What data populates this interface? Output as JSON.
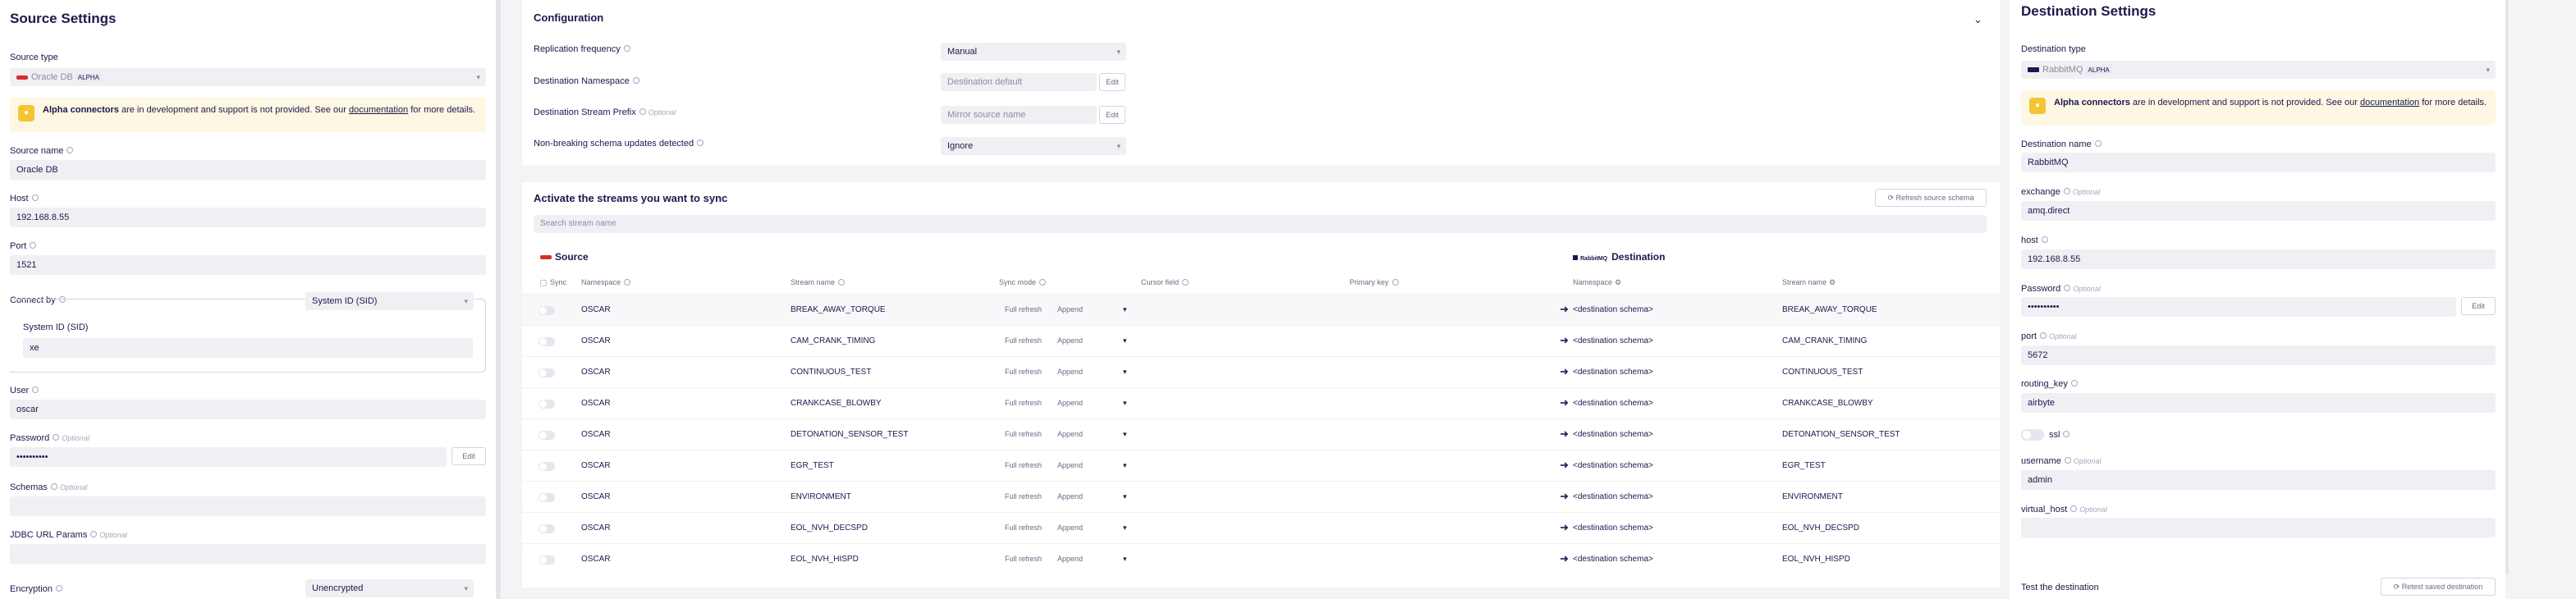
{
  "source": {
    "title": "Source Settings",
    "source_type_label": "Source type",
    "source_type_value": "Oracle DB",
    "alpha_badge": "ALPHA",
    "alert_bold": "Alpha connectors",
    "alert_text": " are in development and support is not provided. See our ",
    "alert_link": "documentation",
    "alert_tail": " for more details.",
    "source_name_label": "Source name",
    "source_name_value": "Oracle DB",
    "host_label": "Host",
    "host_value": "192.168.8.55",
    "port_label": "Port",
    "port_value": "1521",
    "connect_by_label": "Connect by",
    "connect_by_value": "System ID (SID)",
    "sid_label": "System ID (SID)",
    "sid_value": "xe",
    "user_label": "User",
    "user_value": "oscar",
    "password_label": "Password",
    "optional": "Optional",
    "password_value": "••••••••••",
    "edit": "Edit",
    "schemas_label": "Schemas",
    "jdbc_label": "JDBC URL Params",
    "encryption_label": "Encryption",
    "encryption_value": "Unencrypted"
  },
  "config": {
    "title": "Configuration",
    "replication_label": "Replication frequency",
    "replication_value": "Manual",
    "dest_ns_label": "Destination Namespace",
    "dest_ns_value": "Destination default",
    "prefix_label": "Destination Stream Prefix",
    "optional": "Optional",
    "prefix_placeholder": "Mirror source name",
    "nonbreaking_label": "Non-breaking schema updates detected",
    "nonbreaking_value": "Ignore",
    "edit": "Edit"
  },
  "streams": {
    "title": "Activate the streams you want to sync",
    "refresh_button": "Refresh source schema",
    "search_placeholder": "Search stream name",
    "source_header": "Source",
    "destination_header": "Destination",
    "dest_logo_text": "RabbitMQ",
    "columns": {
      "sync": "Sync",
      "namespace": "Namespace",
      "stream_name": "Stream name",
      "sync_mode": "Sync mode",
      "cursor_field": "Cursor field",
      "primary_key": "Primary key",
      "dest_namespace": "Namespace",
      "dest_stream_name": "Stream name"
    },
    "rows": [
      {
        "namespace": "OSCAR",
        "stream": "BREAK_AWAY_TORQUE",
        "mode_a": "Full refresh",
        "mode_b": "Append",
        "dest_ns": "<destination schema>",
        "dest_stream": "BREAK_AWAY_TORQUE"
      },
      {
        "namespace": "OSCAR",
        "stream": "CAM_CRANK_TIMING",
        "mode_a": "Full refresh",
        "mode_b": "Append",
        "dest_ns": "<destination schema>",
        "dest_stream": "CAM_CRANK_TIMING"
      },
      {
        "namespace": "OSCAR",
        "stream": "CONTINUOUS_TEST",
        "mode_a": "Full refresh",
        "mode_b": "Append",
        "dest_ns": "<destination schema>",
        "dest_stream": "CONTINUOUS_TEST"
      },
      {
        "namespace": "OSCAR",
        "stream": "CRANKCASE_BLOWBY",
        "mode_a": "Full refresh",
        "mode_b": "Append",
        "dest_ns": "<destination schema>",
        "dest_stream": "CRANKCASE_BLOWBY"
      },
      {
        "namespace": "OSCAR",
        "stream": "DETONATION_SENSOR_TEST",
        "mode_a": "Full refresh",
        "mode_b": "Append",
        "dest_ns": "<destination schema>",
        "dest_stream": "DETONATION_SENSOR_TEST"
      },
      {
        "namespace": "OSCAR",
        "stream": "EGR_TEST",
        "mode_a": "Full refresh",
        "mode_b": "Append",
        "dest_ns": "<destination schema>",
        "dest_stream": "EGR_TEST"
      },
      {
        "namespace": "OSCAR",
        "stream": "ENVIRONMENT",
        "mode_a": "Full refresh",
        "mode_b": "Append",
        "dest_ns": "<destination schema>",
        "dest_stream": "ENVIRONMENT"
      },
      {
        "namespace": "OSCAR",
        "stream": "EOL_NVH_DECSPD",
        "mode_a": "Full refresh",
        "mode_b": "Append",
        "dest_ns": "<destination schema>",
        "dest_stream": "EOL_NVH_DECSPD"
      },
      {
        "namespace": "OSCAR",
        "stream": "EOL_NVH_HISPD",
        "mode_a": "Full refresh",
        "mode_b": "Append",
        "dest_ns": "<destination schema>",
        "dest_stream": "EOL_NVH_HISPD"
      }
    ]
  },
  "destination": {
    "title": "Destination Settings",
    "type_label": "Destination type",
    "type_value": "RabbitMQ",
    "alpha_badge": "ALPHA",
    "alert_bold": "Alpha connectors",
    "alert_text": " are in development and support is not provided. See our ",
    "alert_link": "documentation",
    "alert_tail": " for more details.",
    "name_label": "Destination name",
    "name_value": "RabbitMQ",
    "exchange_label": "exchange",
    "optional": "Optional",
    "exchange_value": "amq.direct",
    "host_label": "host",
    "host_value": "192.168.8.55",
    "password_label": "Password",
    "password_value": "••••••••••",
    "edit": "Edit",
    "port_label": "port",
    "port_value": "5672",
    "routing_label": "routing_key",
    "routing_value": "airbyte",
    "ssl_label": "ssl",
    "username_label": "username",
    "username_value": "admin",
    "vhost_label": "virtual_host",
    "test_label": "Test the destination",
    "retest_button": "Retest saved destination"
  }
}
